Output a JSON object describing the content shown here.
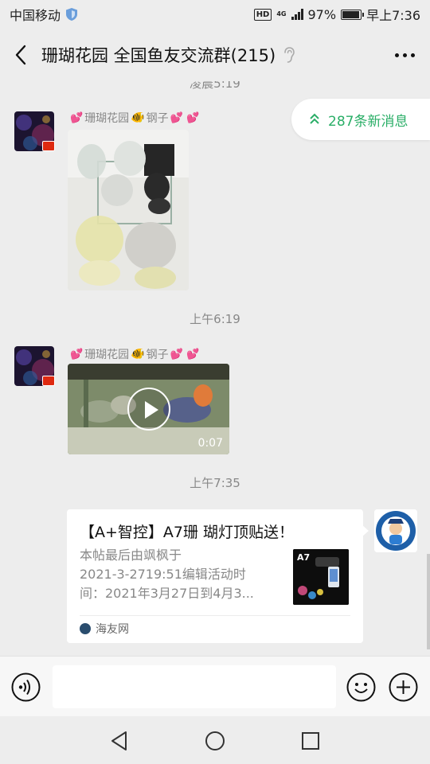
{
  "status": {
    "carrier": "中国移动",
    "hd": "HD",
    "network": "4G",
    "battery": "97%",
    "battery_level": 0.97,
    "time": "早上7:36"
  },
  "header": {
    "title": "珊瑚花园 全国鱼友交流群(215)"
  },
  "new_messages": {
    "label": "287条新消息"
  },
  "timestamps": {
    "t1": "凌晨5:19",
    "t2": "上午6:19",
    "t3": "上午7:35"
  },
  "messages": [
    {
      "sender": "珊瑚花园",
      "sender_suffix": "钢子",
      "type": "image"
    },
    {
      "sender": "珊瑚花园",
      "sender_suffix": "钢子",
      "type": "video",
      "duration": "0:07"
    }
  ],
  "link_card": {
    "title": "【A+智控】A7珊 瑚灯顶贴送！",
    "desc_line1": "本帖最后由飒枫于",
    "desc_line2": "2021-3-2719:51编辑活动时",
    "desc_line3": "间：2021年3月27日到4月3...",
    "thumb_label": "A7",
    "source": "海友网"
  },
  "icons": {
    "back": "chevron-left-icon",
    "more": "more-dots-icon",
    "voice": "voice-icon",
    "emoji": "emoji-icon",
    "plus": "plus-icon",
    "ear": "ear-icon"
  },
  "colors": {
    "accent": "#2aae67",
    "background": "#ededed"
  }
}
